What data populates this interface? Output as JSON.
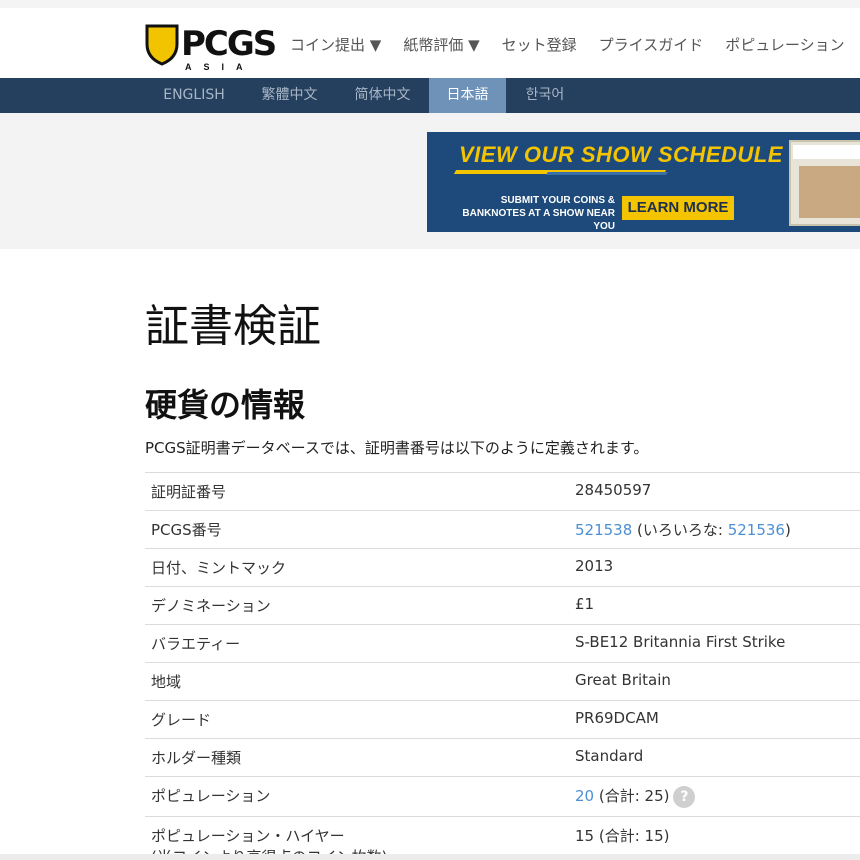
{
  "header": {
    "logo_text": "PCGS",
    "logo_sub": "ASIA",
    "nav": [
      {
        "label": "コイン提出 ▼"
      },
      {
        "label": "紙幣評価 ▼"
      },
      {
        "label": "セット登録"
      },
      {
        "label": "プライスガイド"
      },
      {
        "label": "ポピュレーション"
      }
    ]
  },
  "languages": [
    {
      "label": "ENGLISH"
    },
    {
      "label": "繁體中文"
    },
    {
      "label": "简体中文"
    },
    {
      "label": "日本語"
    },
    {
      "label": "한국어"
    }
  ],
  "banner": {
    "title": "VIEW OUR SHOW SCHEDULE",
    "sub_line1": "SUBMIT YOUR COINS &",
    "sub_line2": "BANKNOTES AT A SHOW NEAR YOU",
    "cta": "LEARN MORE"
  },
  "page_title": "証書検証",
  "section_title": "硬貨の情報",
  "intro": "PCGS証明書データベースでは、証明書番号は以下のように定義されます。",
  "rows": [
    {
      "label": "証明証番号",
      "value": "28450597"
    },
    {
      "label": "PCGS番号",
      "value_link": "521538",
      "value_mid": " (いろいろな: ",
      "value_link2": "521536",
      "value_end": ")"
    },
    {
      "label": "日付、ミントマック",
      "value": "2013"
    },
    {
      "label": "デノミネーション",
      "value": "£1"
    },
    {
      "label": "バラエティー",
      "value": "S-BE12 Britannia First Strike"
    },
    {
      "label": "地域",
      "value": "Great Britain"
    },
    {
      "label": "グレード",
      "value": "PR69DCAM"
    },
    {
      "label": "ホルダー種類",
      "value": "Standard"
    },
    {
      "label": "ポピュレーション",
      "value_link": "20",
      "value_mid": " (合計: 25)",
      "help": "?"
    },
    {
      "label": "ポピュレーション・ハイヤー",
      "label2": "(当コインより高得点のコイン枚数)",
      "value": "15 (合計: 15)"
    }
  ]
}
